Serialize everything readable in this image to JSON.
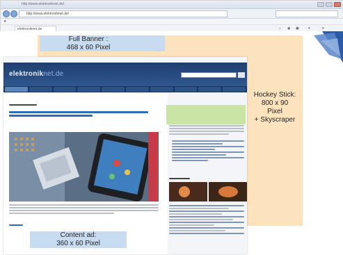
{
  "browser": {
    "title": "http://www.elektroniknet.de/",
    "url": "http://www.elektroniknet.de/",
    "tab_label": "elektroniknet.de"
  },
  "site": {
    "logo_main": "elektronik",
    "logo_accent": "net.de"
  },
  "ads": {
    "full_banner": "Full Banner :\n468 x 60 Pixel",
    "hockey_stick": "Hockey Stick:\n800 x 90\nPixel\n+ Skyscraper",
    "content_ad": "Content ad:\n360 x 60 Pixel"
  },
  "colors": {
    "peach_zone": "#fde3bd",
    "blue_zone": "#c7dcf1",
    "green_zone": "#c9e4a5",
    "site_header": "#1f3e6e",
    "link_blue": "#2f6cb6"
  }
}
